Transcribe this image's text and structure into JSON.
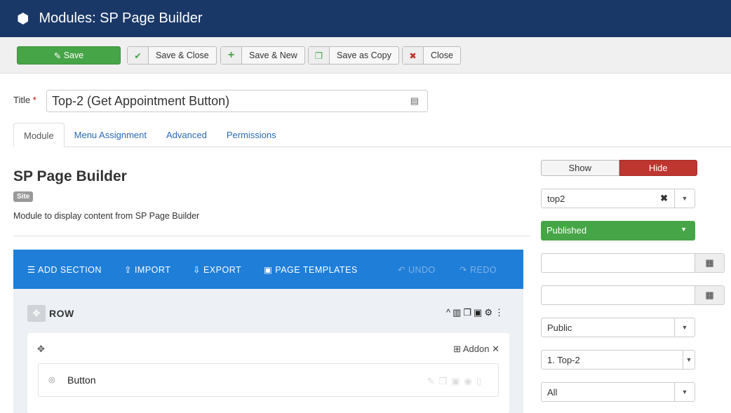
{
  "header": {
    "title": "Modules: SP Page Builder"
  },
  "toolbar": {
    "save": "Save",
    "save_close": "Save & Close",
    "save_new": "Save & New",
    "save_copy": "Save as Copy",
    "close": "Close"
  },
  "form": {
    "title_label": "Title",
    "required": "*",
    "title_value": "Top-2 (Get Appointment Button)"
  },
  "tabs": [
    "Module",
    "Menu Assignment",
    "Advanced",
    "Permissions"
  ],
  "module": {
    "name": "SP Page Builder",
    "badge": "Site",
    "description": "Module to display content from SP Page Builder"
  },
  "builder": {
    "add_section": "ADD SECTION",
    "import": "IMPORT",
    "export": "EXPORT",
    "page_templates": "PAGE TEMPLATES",
    "undo": "UNDO",
    "redo": "REDO",
    "row_label": "ROW",
    "addon_label": "Addon",
    "addon_item": "Button"
  },
  "sidebar": {
    "show": "Show",
    "hide": "Hide",
    "position": "top2",
    "status": "Published",
    "start_date": "",
    "end_date": "",
    "access": "Public",
    "ordering": "1. Top-2",
    "language": "All"
  },
  "colors": {
    "header": "#1a3867",
    "save": "#46a546",
    "builder": "#1f7ed8",
    "hide": "#bd362f"
  }
}
